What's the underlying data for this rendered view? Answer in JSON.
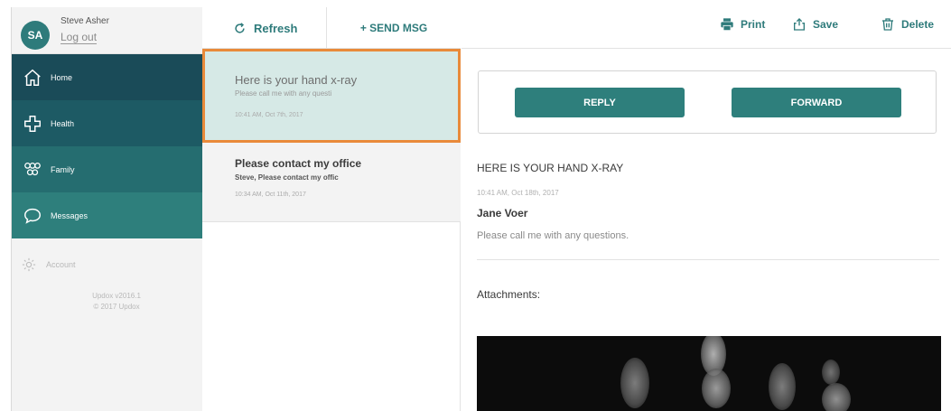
{
  "user": {
    "initials": "SA",
    "name": "Steve Asher",
    "logout_label": "Log out"
  },
  "nav": {
    "home": "Home",
    "health": "Health",
    "family": "Family",
    "messages": "Messages",
    "account": "Account"
  },
  "footer": {
    "version": "Updox v2016.1",
    "copyright": "© 2017 Updox"
  },
  "list_toolbar": {
    "refresh_label": "Refresh",
    "send_label": "+ SEND MSG"
  },
  "messages": [
    {
      "subject": "Here is your hand x-ray",
      "preview": "Please call me with any questi",
      "time": "10:41 AM, Oct 7th, 2017",
      "selected": true
    },
    {
      "subject": "Please contact my office",
      "preview": "Steve, Please contact my offic",
      "time": "10:34 AM, Oct 11th, 2017",
      "selected": false
    }
  ],
  "detail_toolbar": {
    "print_label": "Print",
    "save_label": "Save",
    "delete_label": "Delete"
  },
  "actions": {
    "reply_label": "REPLY",
    "forward_label": "FORWARD"
  },
  "detail": {
    "subject": "HERE IS YOUR HAND X-RAY",
    "time": "10:41 AM, Oct 18th, 2017",
    "sender": "Jane Voer",
    "body": "Please call me with any questions.",
    "attachments_label": "Attachments:"
  },
  "colors": {
    "accent": "#2e7f7c",
    "nav_dark": "#1a4b58",
    "selection_border": "#e98a3a",
    "selection_bg": "#d6e9e6"
  }
}
